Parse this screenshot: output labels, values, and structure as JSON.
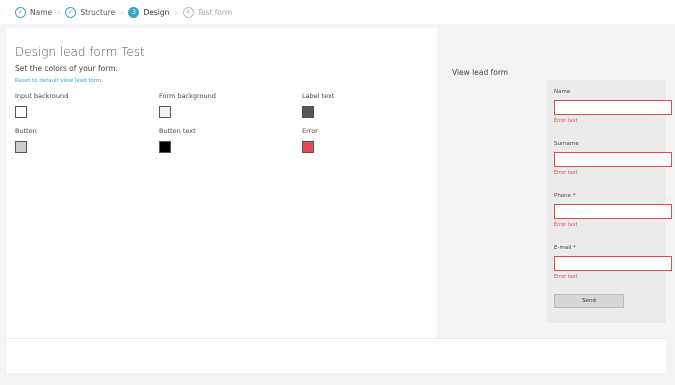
{
  "stepper": {
    "steps": [
      {
        "label": "Name",
        "marker": "✓",
        "state": "done"
      },
      {
        "label": "Structure",
        "marker": "✓",
        "state": "done"
      },
      {
        "label": "Design",
        "marker": "3",
        "state": "active"
      },
      {
        "label": "Test form",
        "marker": "4",
        "state": "pending"
      }
    ],
    "separator": "›"
  },
  "design": {
    "title": "Design lead form Test",
    "subtitle": "Set the colors of your form.",
    "reset_link": "Reset to default view lead form.",
    "colors": [
      {
        "label": "Input backround",
        "color": "#ffffff"
      },
      {
        "label": "Form background",
        "color": "#f0f0f0"
      },
      {
        "label": "Label text",
        "color": "#555555"
      },
      {
        "label": "Button",
        "color": "#cccccc"
      },
      {
        "label": "Button text",
        "color": "#000000"
      },
      {
        "label": "Error",
        "color": "#e84a5a"
      }
    ]
  },
  "preview": {
    "title": "View lead form",
    "fields": [
      {
        "label": "Name",
        "error": "Error text"
      },
      {
        "label": "Surname",
        "error": "Error text"
      },
      {
        "label": "Phone *",
        "error": "Error text"
      },
      {
        "label": "E-mail *",
        "error": "Error text"
      }
    ],
    "send_label": "Send"
  },
  "theme": {
    "accent": "#3aa6c6",
    "error": "#e04a57"
  }
}
